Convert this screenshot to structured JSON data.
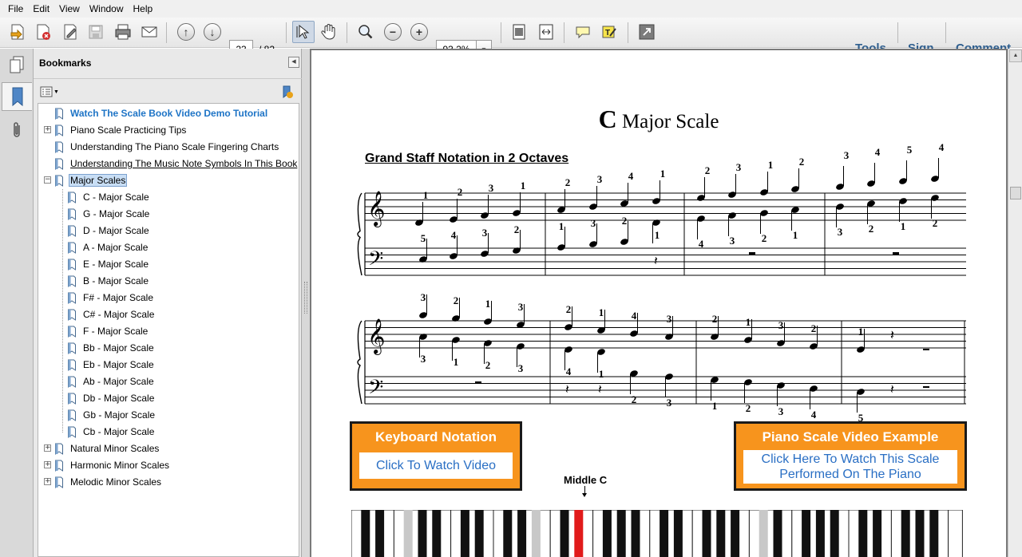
{
  "menu": [
    "File",
    "Edit",
    "View",
    "Window",
    "Help"
  ],
  "toolbar": {
    "current_page": "23",
    "page_total": "/ 82",
    "zoom": "93.2%",
    "right_links": [
      "Tools",
      "Sign",
      "Comment"
    ],
    "icons": [
      "create-pdf-icon",
      "edit-pdf-icon",
      "sign-doc-icon",
      "save-icon",
      "print-icon",
      "email-icon",
      "previous-page-icon",
      "next-page-icon",
      "select-cursor-icon",
      "hand-tool-icon",
      "marquee-zoom-icon",
      "zoom-out-icon",
      "zoom-in-icon",
      "fit-page-icon",
      "fit-width-icon",
      "comment-icon",
      "highlight-icon",
      "full-screen-icon"
    ]
  },
  "bookmarks": {
    "title": "Bookmarks",
    "items": [
      {
        "label": "Watch The Scale Book Video Demo Tutorial",
        "level": 0,
        "style": "link"
      },
      {
        "label": "Piano Scale Practicing Tips",
        "level": 0,
        "expander": "+"
      },
      {
        "label": "Understanding The Piano Scale Fingering Charts",
        "level": 0
      },
      {
        "label": "Understanding The Music Note Symbols In This Book",
        "level": 0,
        "style": "underline"
      },
      {
        "label": "Major Scales",
        "level": 0,
        "expander": "-",
        "style": "selected"
      },
      {
        "label": "C - Major Scale",
        "level": 1
      },
      {
        "label": "G - Major Scale",
        "level": 1
      },
      {
        "label": "D - Major Scale",
        "level": 1
      },
      {
        "label": "A - Major Scale",
        "level": 1
      },
      {
        "label": "E - Major Scale",
        "level": 1
      },
      {
        "label": "B - Major Scale",
        "level": 1
      },
      {
        "label": "F# - Major Scale",
        "level": 1
      },
      {
        "label": "C# - Major Scale",
        "level": 1
      },
      {
        "label": "F - Major Scale",
        "level": 1
      },
      {
        "label": "Bb - Major Scale",
        "level": 1
      },
      {
        "label": "Eb - Major Scale",
        "level": 1
      },
      {
        "label": "Ab - Major Scale",
        "level": 1
      },
      {
        "label": "Db - Major Scale",
        "level": 1
      },
      {
        "label": "Gb - Major Scale",
        "level": 1
      },
      {
        "label": "Cb - Major Scale",
        "level": 1
      },
      {
        "label": "Natural Minor Scales",
        "level": 0,
        "expander": "+"
      },
      {
        "label": "Harmonic Minor Scales",
        "level": 0,
        "expander": "+"
      },
      {
        "label": "Melodic Minor Scales",
        "level": 0,
        "expander": "+"
      }
    ]
  },
  "document": {
    "title_letter": "C",
    "title_rest": "Major Scale",
    "section_title": "Grand Staff Notation in 2 Octaves",
    "keyboard_box": {
      "heading": "Keyboard Notation",
      "link": "Click To Watch Video"
    },
    "video_box": {
      "heading": "Piano Scale Video Example",
      "link": "Click Here To Watch This Scale Performed On The Piano"
    },
    "middle_c_label": "Middle C",
    "fingerings": {
      "sys1_treble": [
        "1",
        "2",
        "3",
        "1",
        "2",
        "3",
        "4",
        "1",
        "2",
        "3",
        "1",
        "2",
        "3",
        "4",
        "5",
        "4"
      ],
      "sys1_treble_lower": [
        "4",
        "3",
        "2",
        "1",
        "3",
        "2",
        "1",
        "2"
      ],
      "sys1_bass": [
        "5",
        "4",
        "3",
        "2",
        "1",
        "3",
        "2",
        "1"
      ],
      "sys2_treble_upper": [
        "3",
        "2",
        "1",
        "3",
        "2",
        "1",
        "4",
        "3",
        "2",
        "1",
        "3",
        "2",
        "1"
      ],
      "sys2_treble_lower": [
        "3",
        "1",
        "2",
        "3",
        "4",
        "1"
      ],
      "sys2_bass": [
        "2",
        "3",
        "1",
        "2",
        "3",
        "4",
        "5"
      ]
    }
  }
}
